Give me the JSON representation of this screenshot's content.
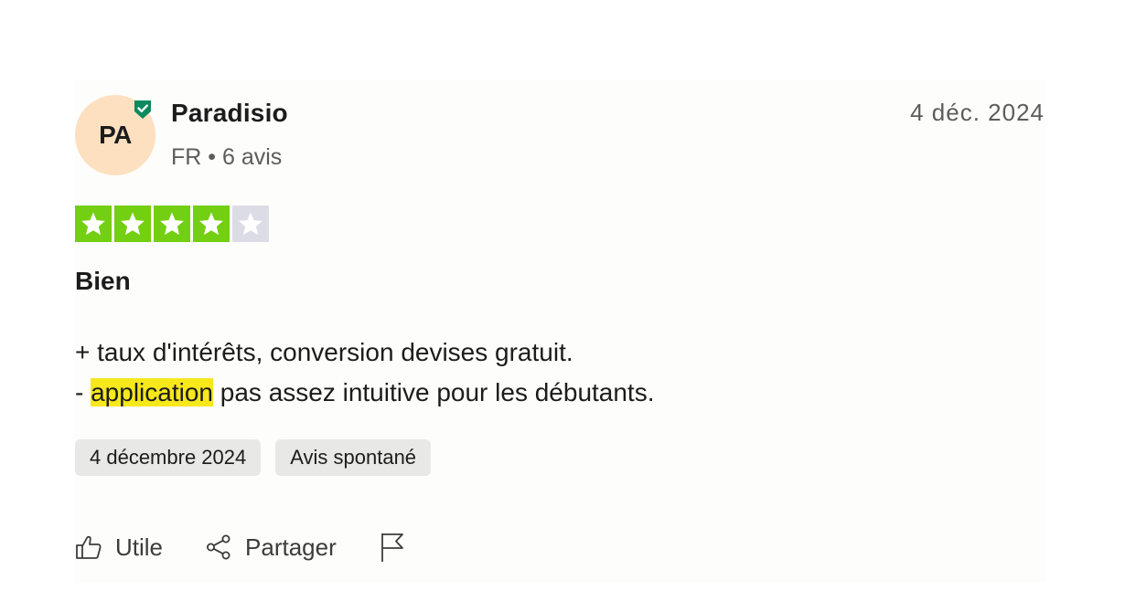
{
  "review": {
    "author": {
      "initials": "PA",
      "name": "Paradisio",
      "country": "FR",
      "separator": "•",
      "review_count": "6 avis"
    },
    "date_short": "4 déc. 2024",
    "rating": 4,
    "rating_max": 5,
    "title": "Bien",
    "body": {
      "line1": "+ taux d'intérêts, conversion devises gratuit.",
      "line2_prefix": "- ",
      "line2_highlight": "application",
      "line2_suffix": " pas assez intuitive pour les débutants."
    },
    "tags": [
      "4 décembre 2024",
      "Avis spontané"
    ],
    "actions": {
      "useful_label": "Utile",
      "share_label": "Partager"
    }
  },
  "colors": {
    "star_filled": "#73cf11",
    "star_empty": "#dcdce6",
    "verified": "#0c8a5e",
    "avatar_bg": "#fde0c0",
    "highlight": "#f7e81c"
  },
  "icons": [
    "verified-badge-icon",
    "thumbs-up-icon",
    "share-icon",
    "flag-icon",
    "star-icon"
  ]
}
